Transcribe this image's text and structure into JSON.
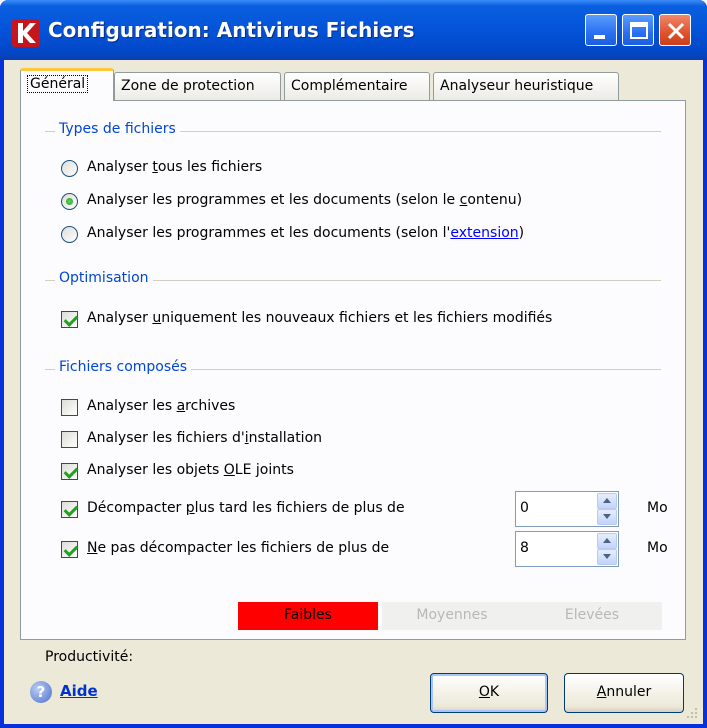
{
  "window": {
    "title": "Configuration: Antivirus Fichiers",
    "icon": "kaspersky-k-icon"
  },
  "tabs": [
    {
      "label": "Général",
      "active": true
    },
    {
      "label": "Zone de protection",
      "active": false
    },
    {
      "label": "Complémentaire",
      "active": false
    },
    {
      "label": "Analyseur heuristique",
      "active": false
    }
  ],
  "types": {
    "title": "Types de fichiers",
    "options": [
      {
        "pre": "Analyser ",
        "u": "t",
        "post": "ous les fichiers",
        "selected": false
      },
      {
        "pre": "Analyser les programmes et les documents (selon le ",
        "u": "c",
        "post": "ontenu)",
        "selected": true
      },
      {
        "pre": "Analyser les programmes et les documents (selon l'",
        "link": "extension",
        "post": ")",
        "selected": false
      }
    ]
  },
  "optim": {
    "title": "Optimisation",
    "option": {
      "pre": "Analyser ",
      "u": "u",
      "post": "niquement les nouveaux fichiers et les fichiers modifiés",
      "checked": true
    }
  },
  "compound": {
    "title": "Fichiers composés",
    "options": [
      {
        "pre": "Analyser les ",
        "u": "a",
        "post": "rchives",
        "checked": false
      },
      {
        "pre": "Analyser les fichiers d'",
        "u": "i",
        "post": "nstallation",
        "checked": false
      },
      {
        "pre": "Analyser les objets ",
        "u": "O",
        "post": "LE joints",
        "checked": true
      },
      {
        "pre": "Décompacter ",
        "u": "p",
        "post": "lus tard les fichiers de plus de",
        "checked": true,
        "value": "0",
        "unit": "Mo"
      },
      {
        "pre": "",
        "u": "N",
        "post": "e pas décompacter les fichiers de plus de",
        "checked": true,
        "value": "8",
        "unit": "Mo"
      }
    ]
  },
  "productivity": {
    "label": "Productivité:",
    "levels": [
      {
        "label": "Faibles",
        "active": true
      },
      {
        "label": "Moyennes",
        "active": false
      },
      {
        "label": "Elevées",
        "active": false
      }
    ],
    "active_color": "#ff0000"
  },
  "buttons": {
    "help": "Aide",
    "ok_u": "O",
    "ok_rest": "K",
    "cancel_u": "A",
    "cancel_rest": "nnuler"
  }
}
